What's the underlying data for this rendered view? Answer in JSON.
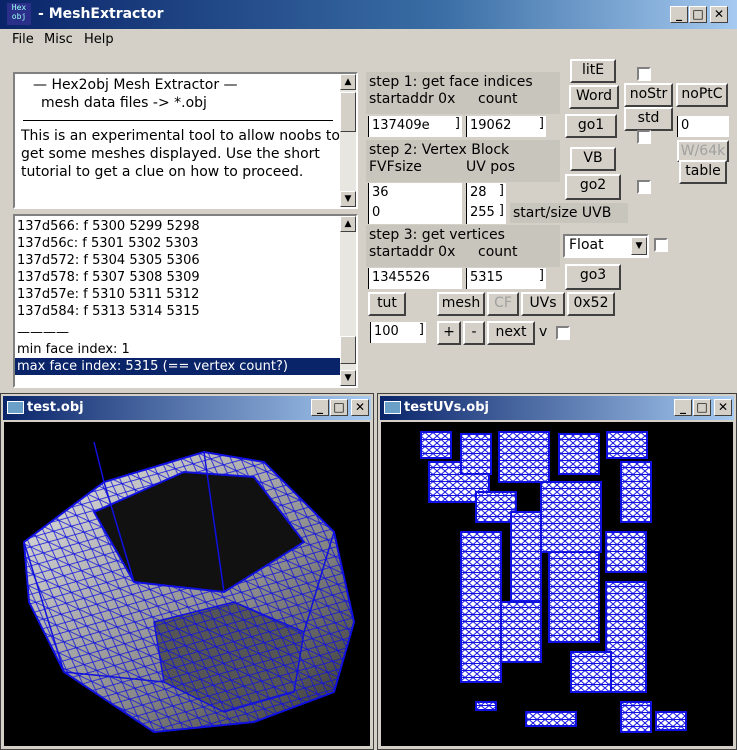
{
  "window": {
    "title": "MeshExtractor",
    "icon_text": "Hex obj",
    "min": "_",
    "max": "□",
    "close": "✕"
  },
  "menu": [
    "File",
    "Misc",
    "Help"
  ],
  "intro": {
    "title": "— Hex2obj Mesh Extractor —",
    "subtitle": "mesh data files -> *.obj",
    "body": "This is an experimental tool to allow noobs to get some meshes displayed. Use the short tutorial to get a clue on how to proceed."
  },
  "face_list": [
    "137d566: f  5300 5299 5298",
    "137d56c: f  5301 5302 5303",
    "137d572: f  5304 5305 5306",
    "137d578: f  5307 5308 5309",
    "137d57e: f  5310 5311 5312",
    "137d584: f  5313 5314 5315",
    "————",
    "min face index: 1",
    "max face index: 5315 (== vertex count?)"
  ],
  "step1": {
    "title": "step 1: get face indices",
    "col1": "startaddr 0x",
    "col2": "count",
    "startaddr": "137409e",
    "count": "19062",
    "go": "go1"
  },
  "step2": {
    "title": "step 2: Vertex Block",
    "col1": "FVFsize",
    "col2": "UV pos",
    "fvf": "36",
    "uvpos": "28",
    "start": "0",
    "size": "255",
    "uvb_label": "start/size UVB",
    "vb": "VB",
    "go": "go2"
  },
  "step3": {
    "title": "step 3: get vertices",
    "col1": "startaddr 0x",
    "col2": "count",
    "startaddr": "1345526",
    "count": "5315",
    "format": "Float",
    "go": "go3"
  },
  "buttons": {
    "lite": "litE",
    "word": "Word",
    "nostr": "noStr",
    "noptc": "noPtC",
    "std": "std",
    "w64k": "W/64k",
    "table": "table",
    "right_entry": "0",
    "tut": "tut",
    "mesh": "mesh",
    "cf": "CF",
    "uvs": "UVs",
    "hex52": "0x52",
    "stepval": "100",
    "plus": "+",
    "minus": "-",
    "next": "next",
    "v": "v"
  },
  "subwin1": {
    "title": "test.obj"
  },
  "subwin2": {
    "title": "testUVs.obj"
  },
  "colors": {
    "mesh_wire": "#1010e0",
    "titlebar": "#0a246a"
  }
}
